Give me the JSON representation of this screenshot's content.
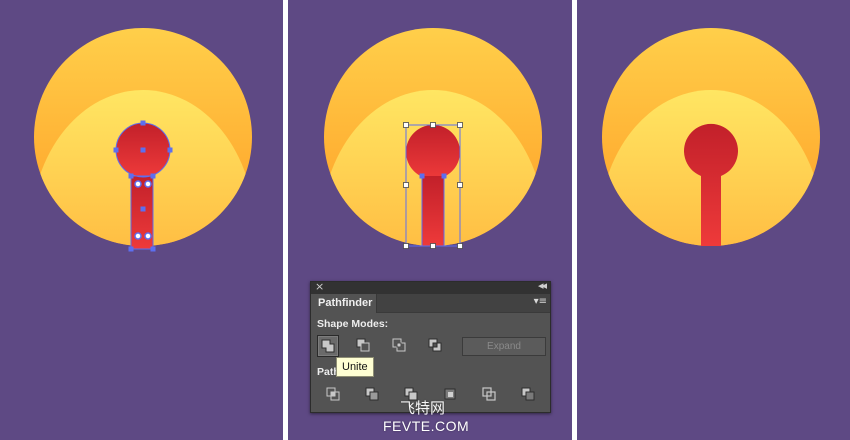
{
  "colors": {
    "background": "#5e4984",
    "separator": "#ffffff",
    "sun_outer_light": "#ffcf4a",
    "sun_outer_dark": "#ff9d25",
    "sun_inner_light": "#ffe663",
    "sun_inner_dark": "#ff9f2a",
    "keyhole_top": "#c2202a",
    "keyhole_bottom": "#ee3a3a",
    "selection": "#5c6ff0"
  },
  "pathfinder": {
    "panel_title": "Pathfinder",
    "close_glyph": "×",
    "collapse_glyph": "◂◂",
    "menu_glyph": "▾≡",
    "shape_modes_label": "Shape Modes:",
    "pathfinders_label": "Path",
    "expand_label": "Expand",
    "tooltip": "Unite",
    "shape_mode_icons": [
      "unite-icon",
      "minus-front-icon",
      "intersect-icon",
      "exclude-icon"
    ],
    "pathfinder_icons": [
      "divide-icon",
      "trim-icon",
      "merge-icon",
      "crop-icon",
      "outline-icon",
      "minus-back-icon"
    ]
  },
  "watermark": {
    "chinese": "飞特网",
    "english": "FEVTE.COM"
  }
}
